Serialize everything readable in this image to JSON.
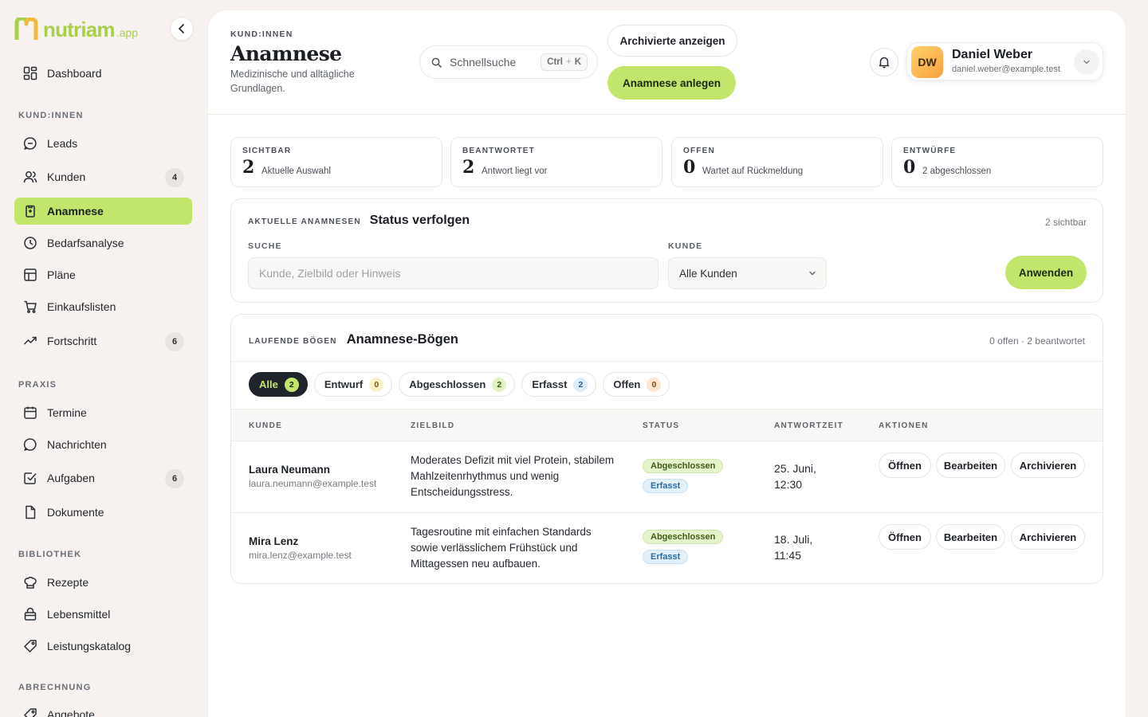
{
  "app": {
    "logo_word": "nutriam",
    "logo_suffix": ".app",
    "accent": "#c2e56b",
    "brand_green": "#a7cf49"
  },
  "sidebar": {
    "dashboard": {
      "label": "Dashboard",
      "icon": "dashboard-icon"
    },
    "sections": [
      {
        "title": "KUND:INNEN",
        "items": [
          {
            "label": "Leads",
            "icon": "chat-bubble-icon"
          },
          {
            "label": "Kunden",
            "icon": "users-icon",
            "badge": "4"
          },
          {
            "label": "Anamnese",
            "icon": "clipboard-icon",
            "active": true
          },
          {
            "label": "Bedarfsanalyse",
            "icon": "clock-icon"
          },
          {
            "label": "Pläne",
            "icon": "table-icon"
          },
          {
            "label": "Einkaufslisten",
            "icon": "cart-icon"
          },
          {
            "label": "Fortschritt",
            "icon": "trend-up-icon",
            "badge": "6"
          }
        ]
      },
      {
        "title": "PRAXIS",
        "items": [
          {
            "label": "Termine",
            "icon": "calendar-icon"
          },
          {
            "label": "Nachrichten",
            "icon": "message-icon"
          },
          {
            "label": "Aufgaben",
            "icon": "checkbox-icon",
            "badge": "6"
          },
          {
            "label": "Dokumente",
            "icon": "document-icon"
          }
        ]
      },
      {
        "title": "BIBLIOTHEK",
        "items": [
          {
            "label": "Rezepte",
            "icon": "chef-hat-icon"
          },
          {
            "label": "Lebensmittel",
            "icon": "shopping-bag-icon"
          },
          {
            "label": "Leistungskatalog",
            "icon": "tag-icon"
          }
        ]
      },
      {
        "title": "ABRECHNUNG",
        "items": [
          {
            "label": "Angebote",
            "icon": "tag-icon"
          }
        ]
      }
    ]
  },
  "header": {
    "eyebrow": "KUND:INNEN",
    "title": "Anamnese",
    "subtitle": "Medizinische und alltägliche Grundlagen.",
    "search_placeholder": "Schnellsuche",
    "shortcut_key1": "Ctrl",
    "shortcut_plus": "+",
    "shortcut_key2": "K",
    "archived_button": "Archivierte anzeigen",
    "create_button": "Anamnese anlegen",
    "user": {
      "initials": "DW",
      "name": "Daniel Weber",
      "email": "daniel.weber@example.test"
    }
  },
  "stats": [
    {
      "label": "SICHTBAR",
      "value": "2",
      "caption": "Aktuelle Auswahl"
    },
    {
      "label": "BEANTWORTET",
      "value": "2",
      "caption": "Antwort liegt vor"
    },
    {
      "label": "OFFEN",
      "value": "0",
      "caption": "Wartet auf Rückmeldung"
    },
    {
      "label": "ENTWÜRFE",
      "value": "0",
      "caption": "2 abgeschlossen"
    }
  ],
  "filter": {
    "eyebrow": "AKTUELLE ANAMNESEN",
    "title": "Status verfolgen",
    "count_text": "2 sichtbar",
    "search_label": "SUCHE",
    "search_placeholder": "Kunde, Zielbild oder Hinweis",
    "customer_label": "KUNDE",
    "customer_value": "Alle Kunden",
    "apply_button": "Anwenden"
  },
  "list": {
    "eyebrow": "LAUFENDE BÖGEN",
    "title": "Anamnese-Bögen",
    "summary": "0 offen · 2 beantwortet",
    "tabs": [
      {
        "label": "Alle",
        "count": "2",
        "active": true
      },
      {
        "label": "Entwurf",
        "count": "0"
      },
      {
        "label": "Abgeschlossen",
        "count": "2"
      },
      {
        "label": "Erfasst",
        "count": "2"
      },
      {
        "label": "Offen",
        "count": "0"
      }
    ],
    "columns": [
      "KUNDE",
      "ZIELBILD",
      "STATUS",
      "ANTWORTZEIT",
      "AKTIONEN"
    ],
    "rows": [
      {
        "name": "Laura Neumann",
        "email": "laura.neumann@example.test",
        "goal": "Moderates Defizit mit viel Protein, stabilem Mahlzeitenrhythmus und wenig Entscheidungsstress.",
        "status1": "Abgeschlossen",
        "status2": "Erfasst",
        "time_line1": "25. Juni,",
        "time_line2": "12:30"
      },
      {
        "name": "Mira Lenz",
        "email": "mira.lenz@example.test",
        "goal": "Tagesroutine mit einfachen Standards sowie verlässlichem Frühstück und Mittagessen neu aufbauen.",
        "status1": "Abgeschlossen",
        "status2": "Erfasst",
        "time_line1": "18. Juli,",
        "time_line2": "11:45"
      }
    ],
    "actions": {
      "open": "Öffnen",
      "edit": "Bearbeiten",
      "archive": "Archivieren"
    }
  }
}
